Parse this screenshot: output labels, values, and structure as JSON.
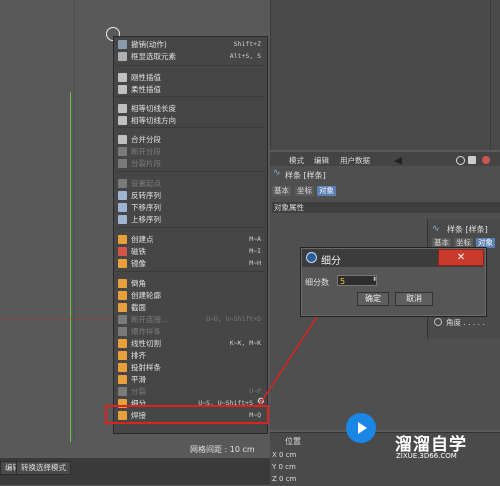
{
  "viewport": {
    "grid_spacing": "网格间距 : 10 cm"
  },
  "statusbar": {
    "left_btn": "编辑",
    "right_btn": "转换选择模式"
  },
  "context_menu": {
    "items": [
      {
        "label": "撤销(动作)",
        "shortcut": "Shift+Z",
        "icon_color": "#8a9bb0",
        "disabled": false
      },
      {
        "label": "框显选取元素",
        "shortcut": "Alt+S, S",
        "icon_color": "#b0b0b0",
        "disabled": false
      },
      {
        "label": "刚性插值",
        "shortcut": "",
        "icon_color": "#c0c0c0",
        "disabled": false
      },
      {
        "label": "柔性插值",
        "shortcut": "",
        "icon_color": "#c0c0c0",
        "disabled": false
      },
      {
        "label": "相等切线长度",
        "shortcut": "",
        "icon_color": "#c0c0c0",
        "disabled": false
      },
      {
        "label": "相等切线方向",
        "shortcut": "",
        "icon_color": "#c0c0c0",
        "disabled": false
      },
      {
        "label": "合并分段",
        "shortcut": "",
        "icon_color": "#c0c0c0",
        "disabled": false
      },
      {
        "label": "断开分段",
        "shortcut": "",
        "icon_color": "#7a7a7a",
        "disabled": true
      },
      {
        "label": "分裂片段",
        "shortcut": "",
        "icon_color": "#7a7a7a",
        "disabled": true
      },
      {
        "label": "设置起点",
        "shortcut": "",
        "icon_color": "#7a7a7a",
        "disabled": true
      },
      {
        "label": "反转序列",
        "shortcut": "",
        "icon_color": "#9fb4d0",
        "disabled": false
      },
      {
        "label": "下移序列",
        "shortcut": "",
        "icon_color": "#9fb4d0",
        "disabled": false
      },
      {
        "label": "上移序列",
        "shortcut": "",
        "icon_color": "#9fb4d0",
        "disabled": false
      },
      {
        "label": "创建点",
        "shortcut": "M~A",
        "icon_color": "#e8a13a",
        "disabled": false
      },
      {
        "label": "磁铁",
        "shortcut": "M~I",
        "icon_color": "#d8534a",
        "disabled": false
      },
      {
        "label": "镜像",
        "shortcut": "M~H",
        "icon_color": "#e8a13a",
        "disabled": false
      },
      {
        "label": "倒角",
        "shortcut": "",
        "icon_color": "#e8a13a",
        "disabled": false
      },
      {
        "label": "创建轮廓",
        "shortcut": "",
        "icon_color": "#e8a13a",
        "disabled": false
      },
      {
        "label": "截面",
        "shortcut": "",
        "icon_color": "#e8a13a",
        "disabled": false
      },
      {
        "label": "断开连接...",
        "shortcut": "U~D, U~Shift+D",
        "icon_color": "#7a7a7a",
        "disabled": true
      },
      {
        "label": "爆炸样条",
        "shortcut": "",
        "icon_color": "#7a7a7a",
        "disabled": true
      },
      {
        "label": "线性切割",
        "shortcut": "K~K, M~K",
        "icon_color": "#e8a13a",
        "disabled": false
      },
      {
        "label": "排齐",
        "shortcut": "",
        "icon_color": "#e8a13a",
        "disabled": false
      },
      {
        "label": "投射样条",
        "shortcut": "",
        "icon_color": "#e8a13a",
        "disabled": false
      },
      {
        "label": "平滑",
        "shortcut": "",
        "icon_color": "#e8a13a",
        "disabled": false
      },
      {
        "label": "分裂",
        "shortcut": "U~P",
        "icon_color": "#7a7a7a",
        "disabled": true
      },
      {
        "label": "细分...",
        "shortcut": "U~S, U~Shift+S",
        "icon_color": "#e8a13a",
        "disabled": false
      },
      {
        "label": "焊接",
        "shortcut": "M~Q",
        "icon_color": "#e8a13a",
        "disabled": false
      }
    ]
  },
  "attributes": {
    "menu": [
      "模式",
      "编辑",
      "用户数据"
    ],
    "title": "样条 [样条]",
    "tabs": [
      "基本",
      "坐标",
      "对象"
    ],
    "section": "对象属性"
  },
  "sub_panel": {
    "title": "样条 [样条]",
    "tabs": [
      "基本",
      "坐标",
      "对象"
    ],
    "row_label": "角度 . . . . ."
  },
  "coords": {
    "title": "位置",
    "rows": [
      "X  0 cm",
      "Y  0 cm",
      "Z  0 cm"
    ]
  },
  "dialog": {
    "title": "细分",
    "field_label": "细分数",
    "value": "5",
    "ok": "确定",
    "cancel": "取消",
    "close": "✕"
  },
  "watermark": {
    "name": "溜溜自学",
    "url": "ZIXUE.3D66.COM"
  }
}
